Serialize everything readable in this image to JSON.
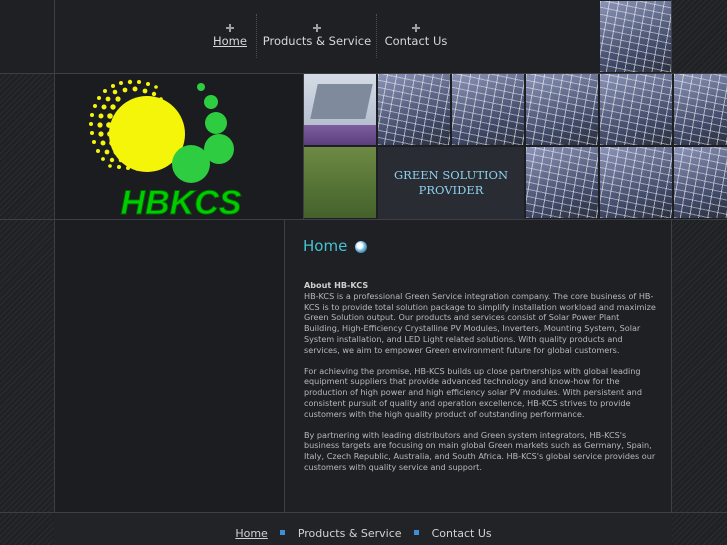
{
  "nav": {
    "items": [
      {
        "label": "Home",
        "active": true,
        "icon": "diamond-dots-icon"
      },
      {
        "label": "Products & Service",
        "active": false,
        "icon": "diamond-dots-icon"
      },
      {
        "label": "Contact Us",
        "active": false,
        "icon": "diamond-dots-icon"
      }
    ]
  },
  "logo": {
    "text": "HBKCS",
    "colors": {
      "sun": "#f5f50a",
      "dots": "#2ecc40",
      "text": "#00cc00"
    }
  },
  "header": {
    "tagline": "GREEN SOLUTION PROVIDER"
  },
  "main": {
    "title": "Home",
    "about_heading": "About HB-KCS",
    "paragraphs": [
      "HB-KCS is a professional Green Service integration company. The core business of HB-KCS is to provide total solution package to simplify installation workload and maximize Green Solution output. Our products and services consist of Solar Power Plant Building, High-Efficiency Crystalline PV Modules, Inverters, Mounting System, Solar System installation, and LED Light related solutions. With quality products and services, we aim to empower Green environment future for global customers.",
      "For achieving the promise, HB-KCS builds up close partnerships with global leading equipment suppliers that provide advanced technology and know-how for the production of high power and high efficiency solar PV modules. With persistent and consistent pursuit of quality and operation excellence, HB-KCS strives to provide customers with the high quality product of outstanding performance.",
      "By partnering with leading distributors and Green system integrators, HB-KCS's business targets are focusing on main global Green markets such as Germany, Spain, Italy, Czech Republic, Australia, and South Africa. HB-KCS's global service provides our customers with quality service and support."
    ]
  },
  "footer": {
    "links": [
      "Home",
      "Products & Service",
      "Contact Us"
    ]
  },
  "colors": {
    "accent": "#45c3d2",
    "tagline": "#8ed0ec",
    "footer_square": "#3d8fd8",
    "background": "#1e1f23"
  }
}
